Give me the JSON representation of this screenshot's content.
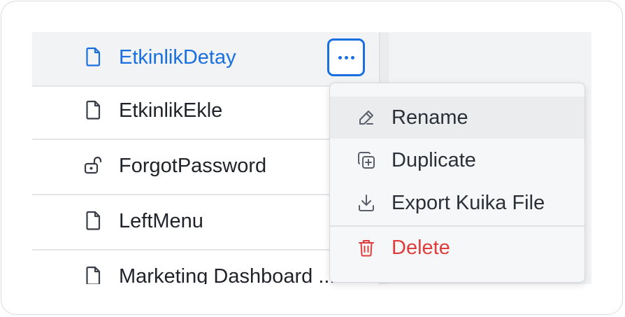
{
  "pages": [
    {
      "name": "EtkinlikDetay",
      "icon": "file-icon",
      "selected": true
    },
    {
      "name": "EtkinlikEkle",
      "icon": "file-icon"
    },
    {
      "name": "ForgotPassword",
      "icon": "unlock-icon"
    },
    {
      "name": "LeftMenu",
      "icon": "file-icon"
    },
    {
      "name": "Marketing Dashboard ...",
      "icon": "file-icon"
    }
  ],
  "context_menu": {
    "items": [
      {
        "label": "Rename",
        "icon": "pencil-icon"
      },
      {
        "label": "Duplicate",
        "icon": "duplicate-icon"
      },
      {
        "label": "Export Kuika File",
        "icon": "download-icon"
      },
      {
        "label": "Delete",
        "icon": "trash-icon"
      }
    ]
  },
  "colors": {
    "accent": "#1a6fe0",
    "danger": "#e03c3c",
    "text": "#1f2329"
  }
}
